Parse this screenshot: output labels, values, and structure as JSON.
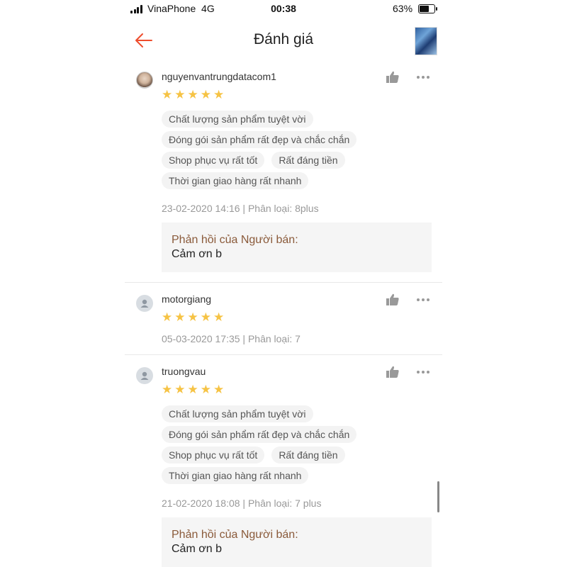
{
  "status_bar": {
    "carrier": "VinaPhone",
    "network": "4G",
    "time": "00:38",
    "battery": "63%"
  },
  "header": {
    "title": "Đánh giá"
  },
  "reviews": [
    {
      "username": "nguyenvantrungdatacom1",
      "rating": 5,
      "tags": [
        "Chất lượng sản phẩm tuyệt vời",
        "Đóng gói sản phẩm rất đẹp và chắc chắn",
        "Shop phục vụ rất tốt",
        "Rất đáng tiền",
        "Thời gian giao hàng rất nhanh"
      ],
      "meta": "23-02-2020 14:16 | Phân loại: 8plus",
      "reply_label": "Phản hồi của Người bán:",
      "reply_text": "Cảm ơn b"
    },
    {
      "username": "motorgiang",
      "rating": 5,
      "meta": "05-03-2020 17:35 | Phân loại: 7"
    },
    {
      "username": "truongvau",
      "rating": 5,
      "tags": [
        "Chất lượng sản phẩm tuyệt vời",
        "Đóng gói sản phẩm rất đẹp và chắc chắn",
        "Shop phục vụ rất tốt",
        "Rất đáng tiền",
        "Thời gian giao hàng rất nhanh"
      ],
      "meta": "21-02-2020 18:08 | Phân loại: 7 plus",
      "reply_label": "Phản hồi của Người bán:",
      "reply_text": "Cảm ơn b"
    }
  ],
  "colors": {
    "accent": "#ee4d2d",
    "star": "#f6c344",
    "reply_label": "#8a5a3a"
  },
  "icons": [
    "back-arrow-icon",
    "thumbs-up-icon",
    "more-icon",
    "star-icon",
    "default-avatar-icon"
  ]
}
